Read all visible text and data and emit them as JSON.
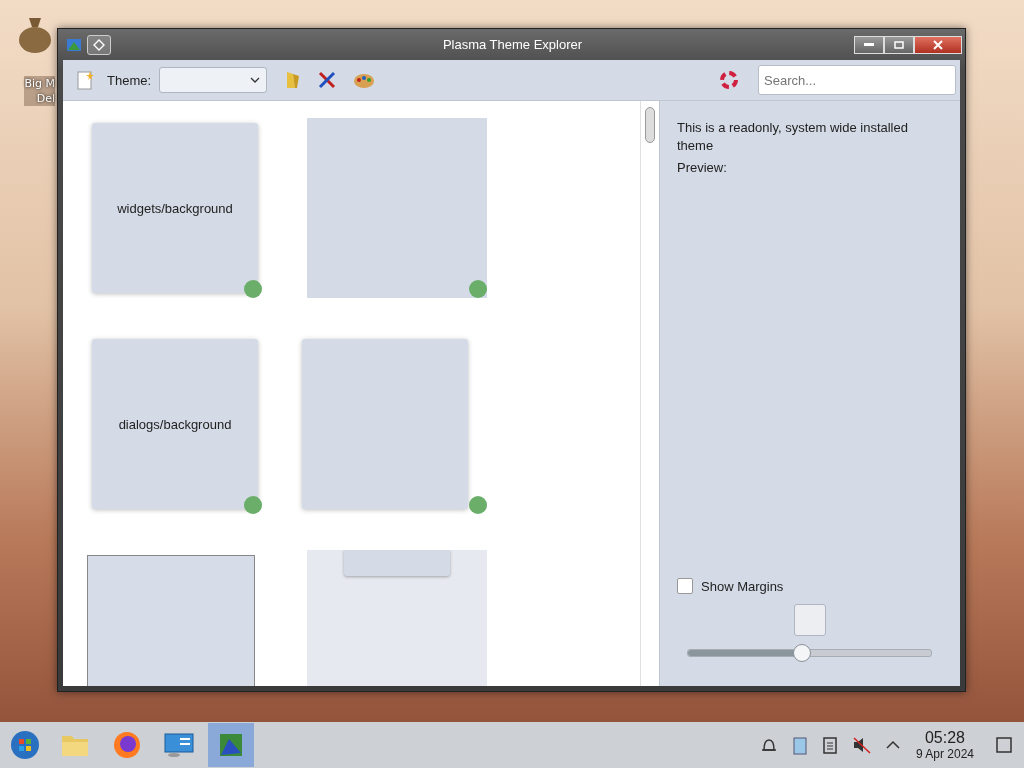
{
  "desktop_icons": [
    {
      "lines": [
        "Big M",
        "Del"
      ]
    }
  ],
  "window": {
    "title": "Plasma Theme Explorer"
  },
  "toolbar": {
    "theme_label": "Theme:",
    "search": {
      "placeholder": "Search..."
    }
  },
  "tiles": [
    {
      "label": "widgets/background",
      "dot": true,
      "kind": "shadowed"
    },
    {
      "dot": true,
      "kind": "flat"
    },
    {
      "label": "dialogs/background",
      "dot": true,
      "kind": "shadowed"
    },
    {
      "dot": true,
      "kind": "shadowed"
    },
    {
      "kind": "outlined"
    },
    {
      "kind": "panel"
    }
  ],
  "details": {
    "description": "This is a readonly, system wide installed theme",
    "preview_label": "Preview:",
    "show_margins": {
      "label": "Show Margins",
      "checked": false
    },
    "zoom": {
      "level": 0.47
    }
  },
  "taskbar": {
    "apps": [
      {
        "selected": false
      },
      {
        "selected": false
      },
      {
        "selected": false
      },
      {
        "selected": true
      }
    ],
    "clock": {
      "time": "05:28",
      "date": "9 Apr 2024"
    }
  }
}
